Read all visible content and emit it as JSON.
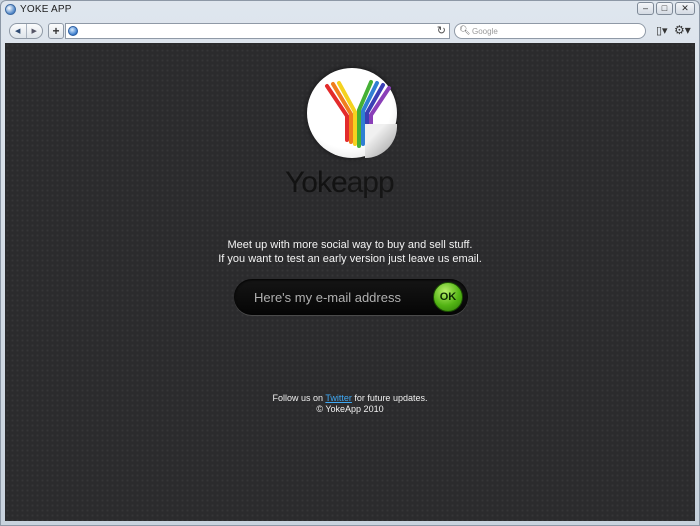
{
  "window": {
    "title": "YOKE APP",
    "controls": {
      "minimize": "–",
      "maximize": "□",
      "close": "✕"
    }
  },
  "toolbar": {
    "back": "◀",
    "forward": "▶",
    "new_tab": "+",
    "reload": "↻",
    "search_placeholder": "Google",
    "page_menu": "▯▾",
    "tools_menu": "⚙▾"
  },
  "page": {
    "brand_bold": "Yoke",
    "brand_light": "app",
    "tagline_line1": "Meet up with more social way to buy and sell stuff.",
    "tagline_line2": "If you want to test an early version just leave us email.",
    "email_placeholder": "Here's my e-mail address",
    "ok_label": "OK",
    "footer_prefix": "Follow us on ",
    "footer_link": "Twitter",
    "footer_suffix": " for future updates.",
    "copyright": "© YokeApp 2010"
  },
  "colors": {
    "background": "#2b2b2d",
    "ok_green": "#53b414",
    "link_blue": "#3fa9f5",
    "logo_stripes": [
      "#e32b2b",
      "#f07d1e",
      "#f5d21f",
      "#45b035",
      "#2f7fd3",
      "#3b3fb5",
      "#8a3fb8"
    ]
  }
}
